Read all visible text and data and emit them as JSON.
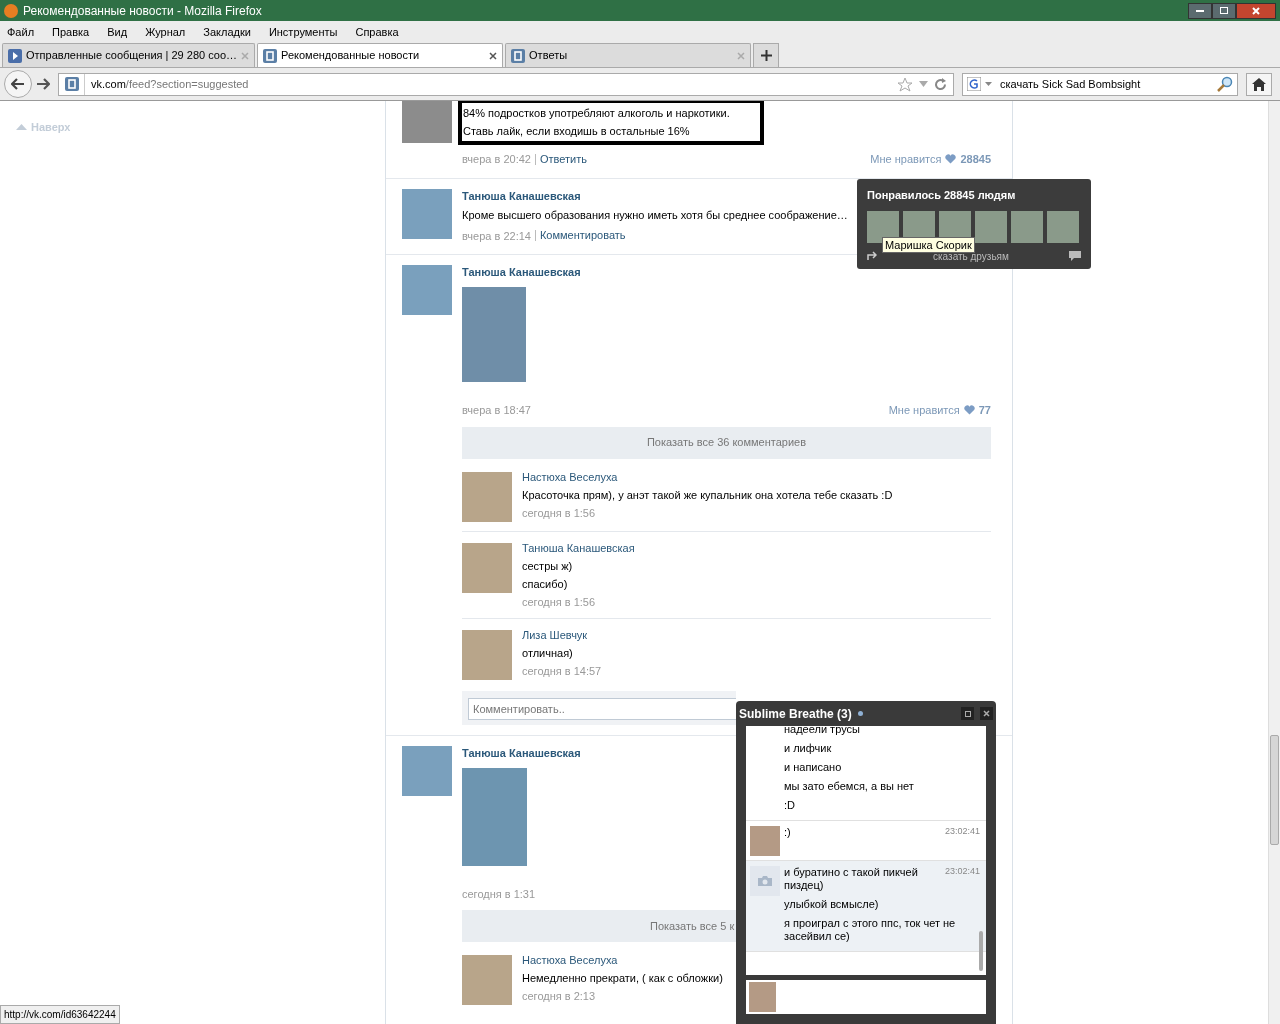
{
  "window": {
    "title": "Рекомендованные новости - Mozilla Firefox"
  },
  "menu": [
    "Файл",
    "Правка",
    "Вид",
    "Журнал",
    "Закладки",
    "Инструменты",
    "Справка"
  ],
  "tabs": [
    {
      "label": "Отправленные сообщения | 29 280 соо…",
      "selected": false,
      "kind": "player"
    },
    {
      "label": "Рекомендованные новости",
      "selected": true,
      "kind": "site"
    },
    {
      "label": "Ответы",
      "selected": false,
      "kind": "site"
    }
  ],
  "address": {
    "host": "vk.com",
    "path": "/feed?section=suggested"
  },
  "search": {
    "value": "скачать Sick Sad Bombsight"
  },
  "sidebar": {
    "up_link": "Наверх"
  },
  "posts": [
    {
      "kind": "text",
      "cut": true,
      "lines": [
        "84% подростков употребляют алкоголь и наркотики.",
        "Ставь лайк, если входишь в остальные 16%"
      ],
      "time": "вчера в 20:42",
      "action": "Ответить",
      "like_label": "Мне нравится",
      "likes": "28845"
    },
    {
      "kind": "text",
      "author": "Танюша Канашевская",
      "lines": [
        "Кроме высшего образования нужно иметь хотя бы среднее соображение…"
      ],
      "time": "вчера в 22:14",
      "action": "Комментировать"
    },
    {
      "kind": "photo",
      "author": "Танюша Канашевская",
      "time": "вчера в 18:47",
      "like_label": "Мне нравится",
      "likes": "77",
      "show_all": "Показать все 36 комментариев",
      "comments": [
        {
          "author": "Настюха Веселуха",
          "lines": [
            "Красоточка прям), у анэт такой же купальник она хотела тебе сказать :D"
          ],
          "time": "сегодня в 1:56"
        },
        {
          "author": "Танюша Канашевская",
          "lines": [
            "сестры ж)",
            "спасибо)"
          ],
          "time": "сегодня в 1:56"
        },
        {
          "author": "Лиза Шевчук",
          "lines": [
            "отличная)"
          ],
          "time": "сегодня в 14:57"
        }
      ],
      "comment_placeholder": "Комментировать.."
    },
    {
      "kind": "photo",
      "author": "Танюша Канашевская",
      "time": "сегодня в 1:31",
      "show_all": "Показать все 5 к",
      "comments": [
        {
          "author": "Настюха Веселуха",
          "lines": [
            "Немедленно прекрати, ( как с обложки)"
          ],
          "time": "сегодня в 2:13"
        }
      ]
    }
  ],
  "likes_popup": {
    "title": "Понравилось 28845 людям",
    "tooltip": "Маришка Скорик",
    "share": "сказать друзьям"
  },
  "chat": {
    "title": "Sublime Breathe (3)",
    "online": true,
    "messages": [
      {
        "kind": "continued",
        "lines": [
          "надеели трусы",
          "и лифчик",
          "и написано",
          "мы зато ебемся, а вы нет",
          ":D"
        ]
      },
      {
        "kind": "photo",
        "time": "23:02:41",
        "lines": [
          ":)"
        ]
      },
      {
        "kind": "no_photo",
        "time": "23:02:41",
        "lines": [
          "и буратино с такой пикчей пиздец)",
          "улыбкой всмысле)",
          "я проиграл с этого ппс, ток чет не засейвил се)"
        ]
      }
    ]
  },
  "status_bar": "http://vk.com/id63642244"
}
